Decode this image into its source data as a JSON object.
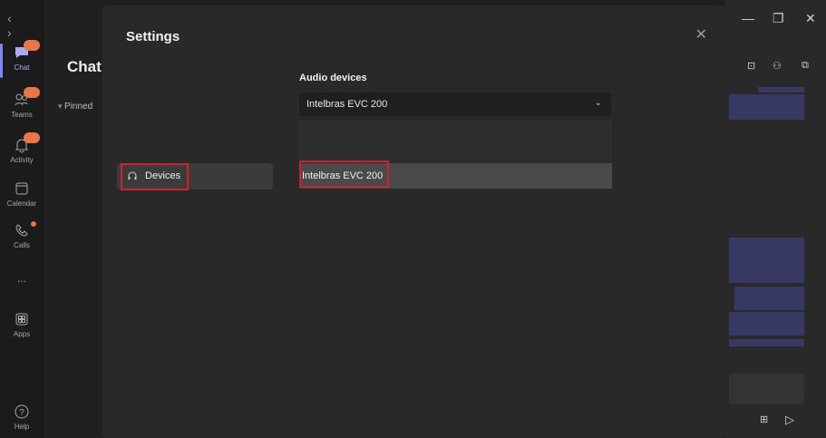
{
  "rail": {
    "items": [
      {
        "label": "Chat",
        "icon": "chat-icon"
      },
      {
        "label": "Teams",
        "icon": "teams-icon"
      },
      {
        "label": "Activity",
        "icon": "bell-icon"
      },
      {
        "label": "Calendar",
        "icon": "calendar-icon"
      },
      {
        "label": "Calls",
        "icon": "phone-icon"
      },
      {
        "label": "...",
        "icon": "more-icon"
      },
      {
        "label": "Apps",
        "icon": "apps-icon"
      },
      {
        "label": "Help",
        "icon": "help-icon"
      }
    ]
  },
  "chatcol": {
    "title": "Chat",
    "pinned": "Pinned"
  },
  "window": {
    "minimize": "—",
    "restore": "❐",
    "close": "✕"
  },
  "modal": {
    "title": "Settings",
    "close": "✕",
    "nav": {
      "devices_label": "Devices"
    },
    "audio": {
      "section_title": "Audio devices",
      "selected": "Intelbras EVC 200",
      "options": [
        "Intelbras EVC 200"
      ]
    }
  },
  "colors": {
    "accent": "#7f85f5",
    "highlight": "#d0202b",
    "badge": "#e97548"
  }
}
